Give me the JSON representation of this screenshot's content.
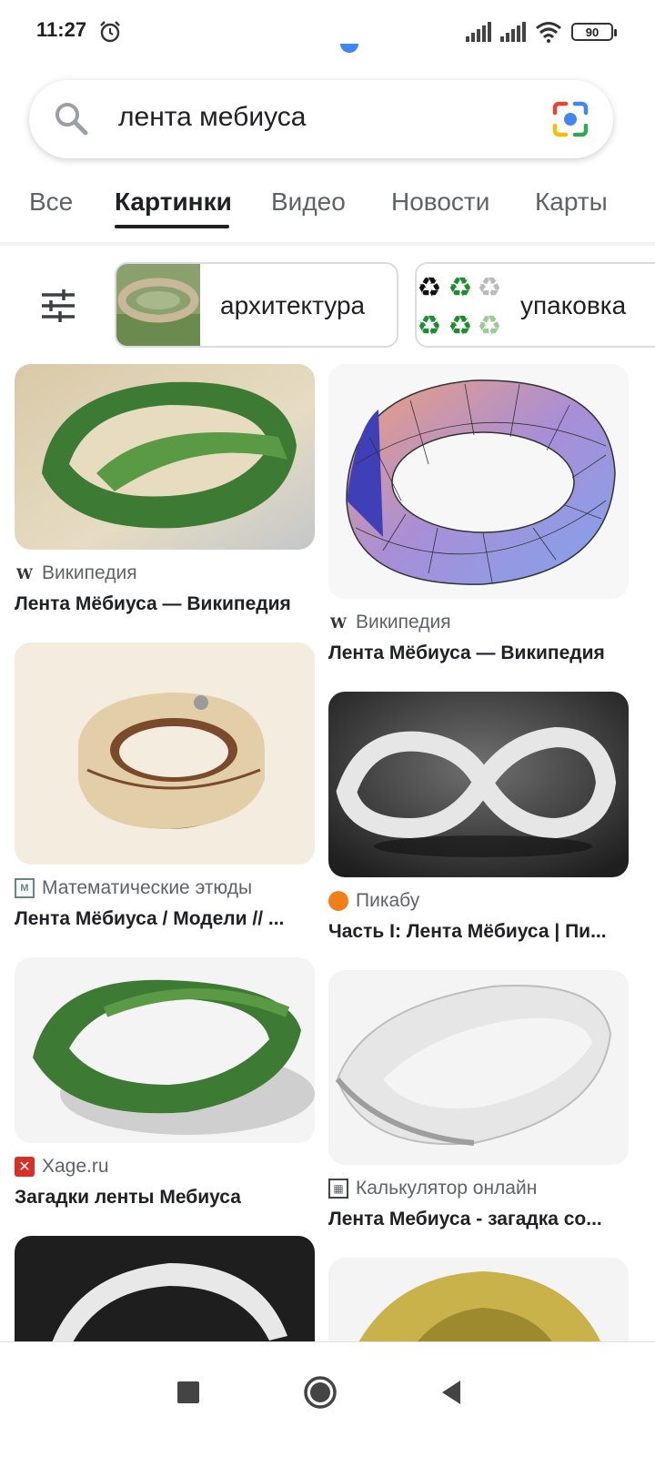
{
  "status": {
    "time": "11:27",
    "battery": "90"
  },
  "search": {
    "query": "лента мебиуса"
  },
  "tabs": [
    "Все",
    "Картинки",
    "Видео",
    "Новости",
    "Карты"
  ],
  "chips": [
    {
      "label": "архитектура"
    },
    {
      "label": "упаковка"
    }
  ],
  "results": [
    {
      "source": "Википедия",
      "title": "Лента Мёбиуса — Википедия"
    },
    {
      "source": "Википедия",
      "title": "Лента Мёбиуса — Википедия"
    },
    {
      "source": "Математические этюды",
      "title": "Лента Мёбиуса / Модели // ..."
    },
    {
      "source": "Пикабу",
      "title": "Часть I: Лента Мёбиуса | Пи..."
    },
    {
      "source": "Xage.ru",
      "title": "Загадки ленты Мебиуса"
    },
    {
      "source": "Калькулятор онлайн",
      "title": "Лента Мебиуса - загадка со..."
    }
  ],
  "colors": {
    "accent": "#4285f4",
    "text": "#202124",
    "muted": "#5f6368"
  }
}
